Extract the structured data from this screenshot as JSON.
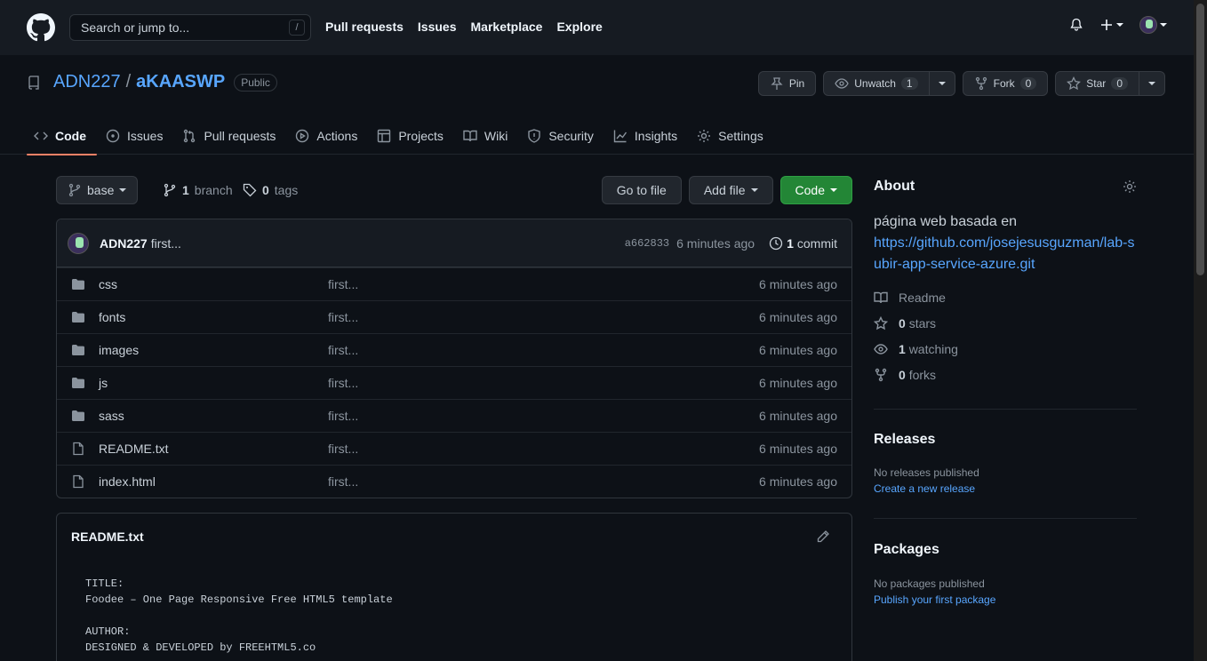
{
  "header": {
    "search_placeholder": "Search or jump to...",
    "search_shortcut": "/",
    "nav": [
      "Pull requests",
      "Issues",
      "Marketplace",
      "Explore"
    ]
  },
  "repo": {
    "owner": "ADN227",
    "separator": "/",
    "name": "aKAASWP",
    "visibility": "Public",
    "actions": {
      "pin": "Pin",
      "unwatch": "Unwatch",
      "unwatch_count": "1",
      "fork": "Fork",
      "fork_count": "0",
      "star": "Star",
      "star_count": "0"
    },
    "tabs": [
      "Code",
      "Issues",
      "Pull requests",
      "Actions",
      "Projects",
      "Wiki",
      "Security",
      "Insights",
      "Settings"
    ]
  },
  "toolbar": {
    "branch": "base",
    "branch_count": "1",
    "branch_label": "branch",
    "tag_count": "0",
    "tag_label": "tags",
    "go_to_file": "Go to file",
    "add_file": "Add file",
    "code": "Code"
  },
  "commit": {
    "author": "ADN227",
    "message": "first...",
    "sha": "a662833",
    "time": "6 minutes ago",
    "count": "1",
    "count_label": "commit"
  },
  "files": [
    {
      "name": "css",
      "type": "dir",
      "message": "first...",
      "age": "6 minutes ago"
    },
    {
      "name": "fonts",
      "type": "dir",
      "message": "first...",
      "age": "6 minutes ago"
    },
    {
      "name": "images",
      "type": "dir",
      "message": "first...",
      "age": "6 minutes ago"
    },
    {
      "name": "js",
      "type": "dir",
      "message": "first...",
      "age": "6 minutes ago"
    },
    {
      "name": "sass",
      "type": "dir",
      "message": "first...",
      "age": "6 minutes ago"
    },
    {
      "name": "README.txt",
      "type": "file",
      "message": "first...",
      "age": "6 minutes ago"
    },
    {
      "name": "index.html",
      "type": "file",
      "message": "first...",
      "age": "6 minutes ago"
    }
  ],
  "readme": {
    "title": "README.txt",
    "content": "TITLE:\nFoodee – One Page Responsive Free HTML5 template\n\nAUTHOR:\nDESIGNED & DEVELOPED by FREEHTML5.co"
  },
  "about": {
    "title": "About",
    "description": "página web basada en",
    "link": "https://github.com/josejesusguzman/lab-subir-app-service-azure.git",
    "readme": "Readme",
    "stars_count": "0",
    "stars_label": "stars",
    "watching_count": "1",
    "watching_label": "watching",
    "forks_count": "0",
    "forks_label": "forks"
  },
  "releases": {
    "title": "Releases",
    "empty": "No releases published",
    "link": "Create a new release"
  },
  "packages": {
    "title": "Packages",
    "empty": "No packages published",
    "link": "Publish your first package"
  },
  "colors": {
    "bg": "#0d1117",
    "header": "#161b22",
    "accent_link": "#58a6ff",
    "primary_button": "#238636",
    "tab_underline": "#f78166"
  }
}
